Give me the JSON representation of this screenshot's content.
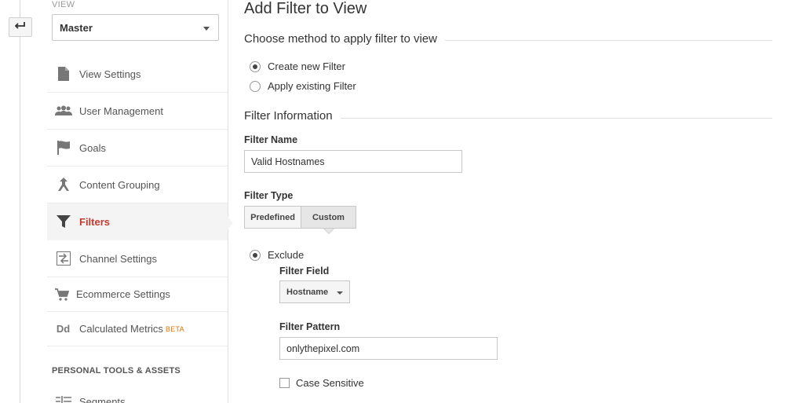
{
  "sidebar": {
    "view_label": "VIEW",
    "view_selected": "Master",
    "items": [
      {
        "label": "View Settings",
        "icon": "document-icon"
      },
      {
        "label": "User Management",
        "icon": "users-icon"
      },
      {
        "label": "Goals",
        "icon": "flag-icon"
      },
      {
        "label": "Content Grouping",
        "icon": "grouping-icon"
      },
      {
        "label": "Filters",
        "icon": "filter-icon",
        "active": true
      },
      {
        "label": "Channel Settings",
        "icon": "channel-settings-icon"
      },
      {
        "label": "Ecommerce Settings",
        "icon": "cart-icon"
      },
      {
        "label": "Calculated Metrics",
        "icon": "calculated-metrics-icon",
        "badge": "BETA"
      }
    ],
    "section_heading": "PERSONAL TOOLS & ASSETS",
    "segments_label": "Segments"
  },
  "main": {
    "title": "Add Filter to View",
    "method_legend": "Choose method to apply filter to view",
    "method_options": [
      {
        "label": "Create new Filter",
        "checked": true
      },
      {
        "label": "Apply existing Filter",
        "checked": false
      }
    ],
    "info_legend": "Filter Information",
    "filter_name_label": "Filter Name",
    "filter_name_value": "Valid Hostnames",
    "filter_type_label": "Filter Type",
    "type_predefined": "Predefined",
    "type_custom": "Custom",
    "exclude_label": "Exclude",
    "filter_field_label": "Filter Field",
    "filter_field_value": "Hostname",
    "filter_pattern_label": "Filter Pattern",
    "filter_pattern_value": "onlythepixel.com",
    "case_sensitive_label": "Case Sensitive"
  },
  "colors": {
    "active_nav": "#c13b2f",
    "beta_badge": "#e37400"
  }
}
